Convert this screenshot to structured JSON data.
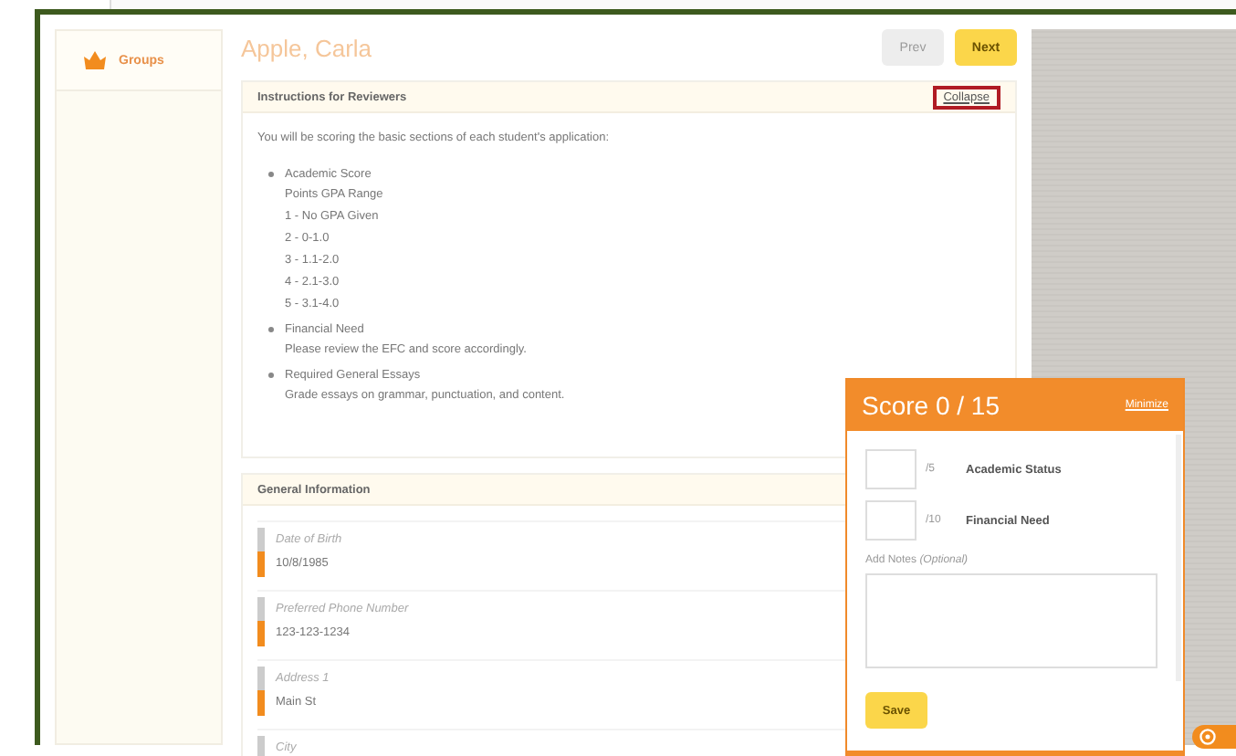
{
  "sidebar": {
    "items": [
      {
        "label": "Groups",
        "selected": true
      }
    ]
  },
  "applicant": {
    "name": "Apple, Carla"
  },
  "nav": {
    "buttons": [
      {
        "label": "Prev",
        "disabled": true
      },
      {
        "label": "Next",
        "disabled": false
      }
    ]
  },
  "instructions": {
    "title": "Instructions for Reviewers",
    "toggle": "Collapse",
    "intro": "You will be scoring the basic sections of each student's application:",
    "bullets": [
      {
        "label": "Academic Score",
        "lines": [
          "Points GPA Range",
          "1 - No GPA Given",
          "2 - 0-1.0",
          "3 - 1.1-2.0",
          "4 - 2.1-3.0",
          "5 - 3.1-4.0"
        ]
      },
      {
        "label": "Financial Need",
        "lines": [
          "Please review the EFC and score accordingly."
        ]
      },
      {
        "label": "Required General Essays",
        "lines": [
          "Grade essays on grammar, punctuation, and content."
        ]
      }
    ]
  },
  "general_information": {
    "title": "General Information",
    "fields": [
      {
        "label": "Date of Birth",
        "value": "10/8/1985"
      },
      {
        "label": "Preferred Phone Number",
        "value": "123-123-1234"
      },
      {
        "label": "Address 1",
        "value": "Main St"
      },
      {
        "label": "City"
      }
    ]
  },
  "score_panel": {
    "title": "Score 0 / 15",
    "minimize": "Minimize",
    "criteria": [
      {
        "max": "/5",
        "label": "Academic Status"
      },
      {
        "max": "/10",
        "label": "Financial Need"
      }
    ],
    "notes_label": "Add Notes *(Optional)*",
    "save": "Save"
  }
}
